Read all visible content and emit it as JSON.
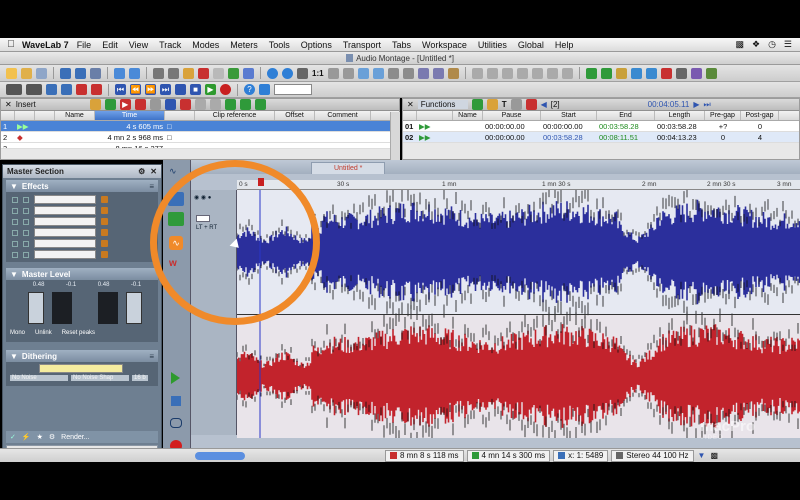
{
  "menubar": {
    "app_name": "WaveLab 7",
    "items": [
      "File",
      "Edit",
      "View",
      "Track",
      "Modes",
      "Meters",
      "Tools",
      "Options",
      "Transport",
      "Tabs",
      "Workspace",
      "Utilities",
      "Global",
      "Help"
    ]
  },
  "window": {
    "title": "Audio Montage - [Untitled *]"
  },
  "toolbar2": {
    "zoom_label": "1:1"
  },
  "insert_pane": {
    "title": "Insert",
    "columns": [
      "Name",
      "Time",
      "Clip reference",
      "Offset",
      "Comment"
    ],
    "rows": [
      {
        "num": "1",
        "time": "4 s 605 ms",
        "selected": true
      },
      {
        "num": "2",
        "time": "4 mn 2 s 968 ms",
        "selected": false
      },
      {
        "num": "3",
        "time": "8 mn 16 s 277",
        "selected": false
      }
    ]
  },
  "functions_pane": {
    "title": "Functions",
    "marker": "[2]",
    "time": "00:04:05.11",
    "columns": [
      "Name",
      "Pause",
      "Start",
      "End",
      "Length",
      "Pre-gap",
      "Post-gap"
    ],
    "rows": [
      {
        "num": "01",
        "pause": "00:00:00.00",
        "start": "00:00:00.00",
        "end": "00:03:58.28",
        "length": "00:03:58.28",
        "pregap": "+?",
        "postgap": "0"
      },
      {
        "num": "02",
        "pause": "00:00:00.00",
        "start": "00:03:58.28",
        "end": "00:08:11.51",
        "length": "00:04:13.23",
        "pregap": "0",
        "postgap": "4"
      }
    ]
  },
  "master_section": {
    "title": "Master Section",
    "effects_label": "Effects",
    "master_level_label": "Master Level",
    "level_values": [
      "0.48",
      "-0.1",
      "0.48",
      "-0.1"
    ],
    "level_buttons": [
      "Mono",
      "Unlink",
      "Reset peaks"
    ],
    "dithering_label": "Dithering",
    "noise_labels": [
      "No Noise",
      "No Noise Shap",
      "16 b"
    ],
    "render_label": "Render..."
  },
  "montage": {
    "tab_label": "Untitled *",
    "track_name": "LT + RT",
    "ruler_labels": [
      "0 s",
      "30 s",
      "1 mn",
      "1 mn 30 s",
      "2 mn",
      "2 mn 30 s",
      "3 mn"
    ]
  },
  "statusbar": {
    "cursor_time": "8 mn 8 s 118 ms",
    "selection_time": "4 mn 14 s 300 ms",
    "zoom": "x: 1: 5489",
    "format": "Stereo 44 100 Hz"
  },
  "watermark": {
    "brand": "macPro",
    "sub": "VIDEO"
  },
  "colors": {
    "left_channel": "#2b2f9c",
    "right_channel": "#c2232c",
    "highlight": "#f08a2a"
  }
}
